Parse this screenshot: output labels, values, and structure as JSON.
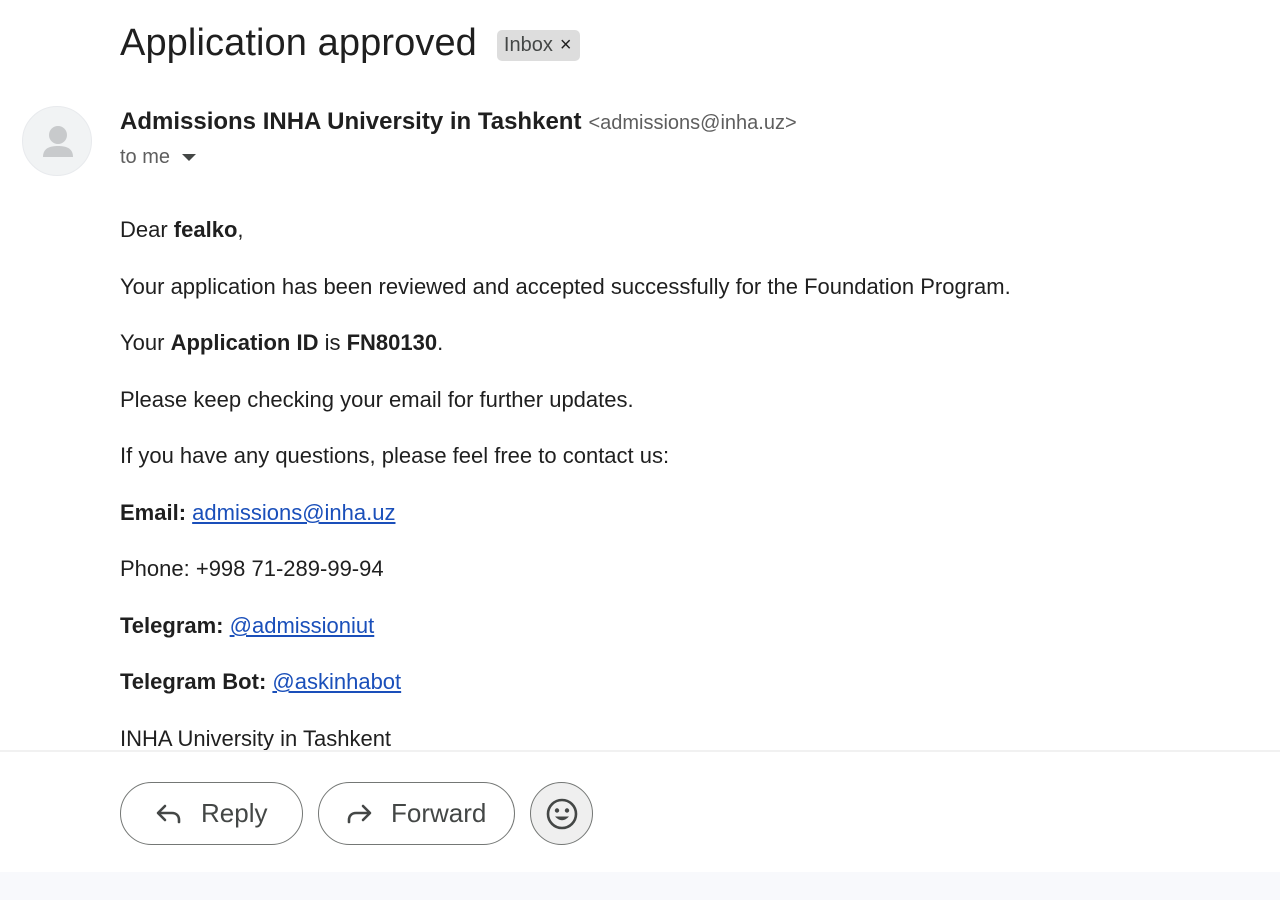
{
  "message": {
    "subject": "Application approved",
    "label": "Inbox",
    "label_remove_glyph": "×"
  },
  "sender": {
    "name": "Admissions INHA University in Tashkent",
    "email": "<admissions@inha.uz>",
    "avatar_icon": "person-icon"
  },
  "recipient": {
    "text": "to me",
    "details_icon": "caret-down-icon"
  },
  "body": {
    "greeting_prefix": "Dear ",
    "greeting_name": "fealko",
    "greeting_suffix": ",",
    "accepted_line": "Your application has been reviewed and accepted successfully for the Foundation Program.",
    "app_id_prefix": "Your ",
    "app_id_label": "Application ID",
    "app_id_mid": " is ",
    "app_id_value": "FN80130",
    "app_id_suffix": ".",
    "updates_line": "Please keep checking your email for further updates.",
    "questions_line": "If you have any questions, please feel free to contact us:",
    "email_label": "Email:",
    "email_link": "admissions@inha.uz",
    "phone_line": "Phone: +998 71-289-99-94",
    "telegram_label": "Telegram:",
    "telegram_link": "@admissioniut",
    "telegram_bot_label": "Telegram Bot:",
    "telegram_bot_link": "@askinhabot",
    "signature": "INHA University in Tashkent"
  },
  "actions": {
    "reply_label": "Reply",
    "forward_label": "Forward",
    "reply_icon": "reply-arrow-icon",
    "forward_icon": "forward-arrow-icon",
    "emoji_icon": "smiley-icon"
  },
  "colors": {
    "link": "#1a4fba",
    "text": "#1f1f1f",
    "muted": "#5e5e5e",
    "chip_bg": "#dddddd"
  }
}
